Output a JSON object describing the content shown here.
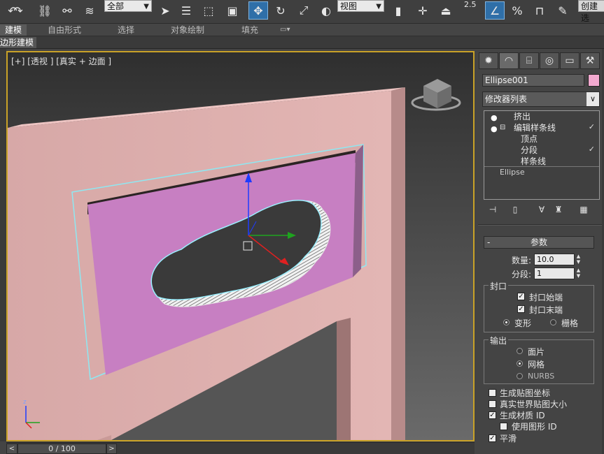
{
  "toolbar": {
    "selection_filter": "全部",
    "reference_coord": "视图",
    "snap_angle_label": "2.5",
    "percent_snap_label": "%",
    "create_selection_label": "创建选"
  },
  "ribbon": {
    "tabs": [
      "建模",
      "自由形式",
      "选择",
      "对象绘制",
      "填充"
    ],
    "active_tab": "建模",
    "subtab": "边形建模"
  },
  "viewport": {
    "label": "[+] [透视 ] [真实 + 边面 ]",
    "border_color": "#c9a227",
    "gizmo_axis_z": "z"
  },
  "timeline": {
    "frame_display": "0 / 100",
    "left_arrow": "<",
    "right_arrow": ">"
  },
  "panel": {
    "tabs": [
      "create-icon",
      "modify-icon",
      "hierarchy-icon",
      "motion-icon",
      "display-icon",
      "utilities-icon"
    ],
    "object_name": "Ellipse001",
    "object_color": "#f2a9cf",
    "modifier_list_label": "修改器列表",
    "stack": {
      "items": [
        {
          "label": "挤出",
          "level": 0,
          "bulb": true,
          "expand": false
        },
        {
          "label": "编辑样条线",
          "level": 0,
          "bulb": true,
          "expand": true
        },
        {
          "label": "顶点",
          "level": 1
        },
        {
          "label": "分段",
          "level": 1
        },
        {
          "label": "样条线",
          "level": 1
        },
        {
          "label": "Ellipse",
          "level": 0,
          "base": true
        }
      ]
    },
    "parameters": {
      "title": "参数",
      "amount_label": "数量:",
      "amount_value": "10.0",
      "segments_label": "分段:",
      "segments_value": "1",
      "capping": {
        "title": "封口",
        "cap_start": "封口始端",
        "cap_end": "封口末端",
        "cap_start_checked": true,
        "cap_end_checked": true,
        "morph": "变形",
        "grid": "栅格",
        "selected": "变形"
      },
      "output": {
        "title": "输出",
        "patch": "面片",
        "mesh": "网格",
        "nurbs": "NURBS",
        "selected": "网格"
      },
      "gen_mapping": "生成贴图坐标",
      "real_world": "真实世界贴图大小",
      "gen_mat_ids": "生成材质 ID",
      "use_shape_ids": "使用图形 ID",
      "smooth": "平滑",
      "checked": {
        "gen_mapping": false,
        "real_world": false,
        "gen_mat_ids": true,
        "use_shape_ids": false,
        "smooth": true
      }
    }
  }
}
